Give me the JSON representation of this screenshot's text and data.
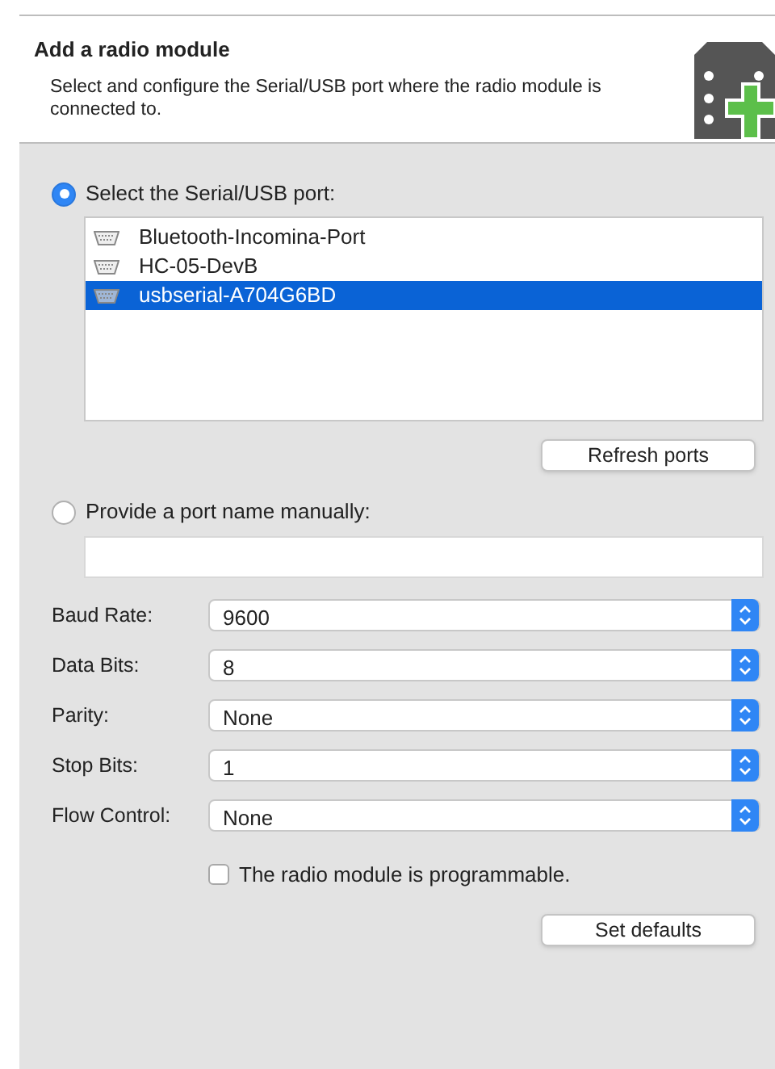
{
  "header": {
    "title": "Add a radio module",
    "description": "Select and configure the Serial/USB port where the radio module is connected to."
  },
  "port_choice": [
    {
      "label": "Select the Serial/USB port:",
      "selected": true
    },
    {
      "label": "Provide a port name manually:",
      "selected": false
    }
  ],
  "ports": [
    {
      "name": "Bluetooth-Incomina-Port",
      "selected": false
    },
    {
      "name": "HC-05-DevB",
      "selected": false
    },
    {
      "name": "usbserial-A704G6BD",
      "selected": true
    }
  ],
  "refresh_button": "Refresh ports",
  "settings": [
    {
      "label": "Baud Rate:",
      "value": "9600"
    },
    {
      "label": "Data Bits:",
      "value": "8"
    },
    {
      "label": "Parity:",
      "value": "None"
    },
    {
      "label": "Stop Bits:",
      "value": "1"
    },
    {
      "label": "Flow Control:",
      "value": "None"
    }
  ],
  "programmable": {
    "label": "The radio module is programmable.",
    "checked": false
  },
  "defaults_button": "Set defaults"
}
